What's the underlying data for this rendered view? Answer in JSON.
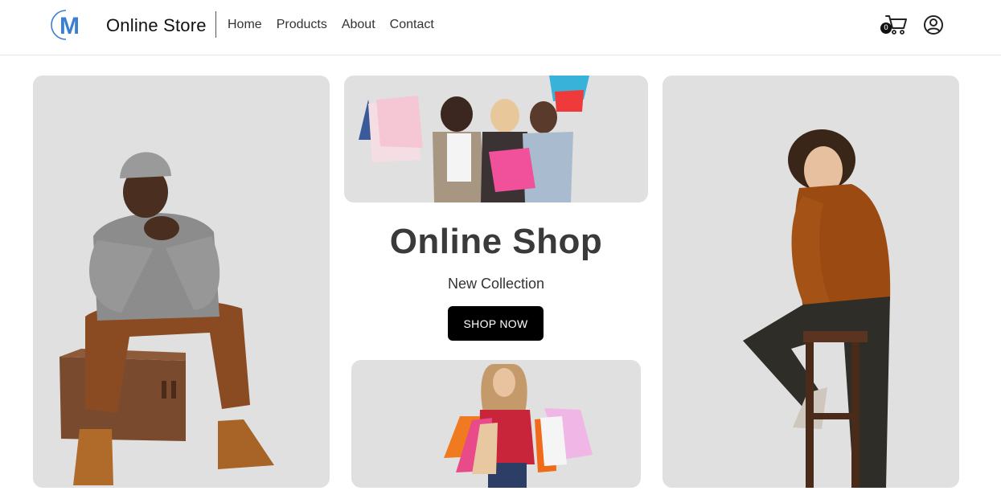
{
  "header": {
    "brand": "Online Store",
    "logo_letter": "M",
    "nav": [
      "Home",
      "Products",
      "About",
      "Contact"
    ],
    "cart_count": "0",
    "icons": {
      "cart": "cart-icon",
      "user": "user-circle-icon",
      "logo": "m-logo"
    }
  },
  "hero": {
    "title": "Online Shop",
    "subtitle": "New Collection",
    "button_label": "SHOP NOW"
  },
  "images": {
    "left": "man-gray-sweater-sitting-on-box",
    "top": "women-with-shopping-bags",
    "bottom": "woman-red-sweater-with-shopping-bags",
    "right": "man-orange-turtleneck-on-stool"
  },
  "colors": {
    "panel_bg": "#e0e0e0",
    "button_bg": "#000000",
    "logo_blue": "#3b7fd1",
    "title": "#3a3a3a"
  }
}
